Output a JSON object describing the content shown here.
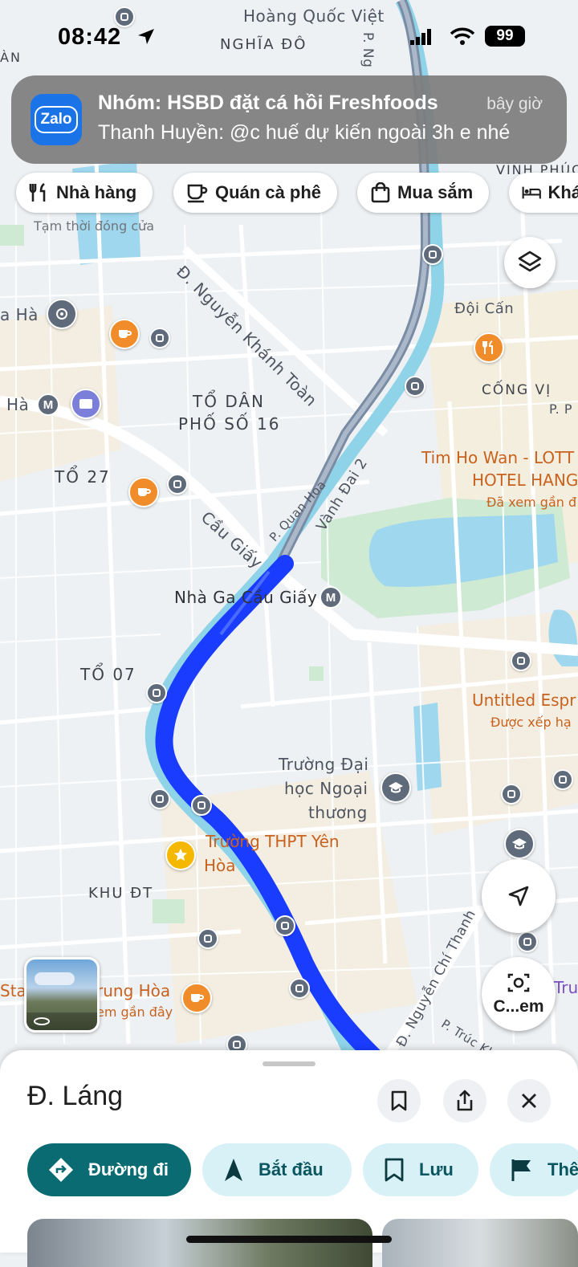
{
  "status_bar": {
    "time": "08:42",
    "battery": "99"
  },
  "notification": {
    "app": "Zalo",
    "title": "Nhóm: HSBD đặt cá hồi Freshfoods",
    "time": "bây giờ",
    "message": "Thanh Huyền: @c huế dự kiến ngoài 3h e nhé"
  },
  "chips": [
    {
      "label": "Nhà hàng",
      "icon": "fork-knife-icon"
    },
    {
      "label": "Quán cà phê",
      "icon": "coffee-cup-icon"
    },
    {
      "label": "Mua sắm",
      "icon": "shopping-bag-icon"
    },
    {
      "label": "Khá",
      "icon": "bed-icon"
    }
  ],
  "map": {
    "labels": {
      "hoang_quoc_viet": "Hoàng Quốc Việt",
      "nghia_do": "NGHĨA ĐÔ",
      "an": "ÀN",
      "p_ng": "P. Ng",
      "vinh_phuc": "VĨNH PHÚC",
      "tam_thoi": "Tạm thời đóng cửa",
      "nguyen_khanh_toan": "Đ. Nguyễn Khánh Toàn",
      "a_ha": "a Hà",
      "doi_can": "Đội Cấn",
      "cong_vi": "CỐNG VỊ",
      "pp": "P. P",
      "ha": "Hà",
      "to_dan_1": "TỔ DÂN",
      "to_dan_2": "PHỐ SỐ 16",
      "tim_ho_wan": "Tim Ho Wan - LOTT",
      "hotel_hang": "HOTEL HANG",
      "da_xem": "Đã xem gần đ",
      "to_27": "TỔ 27",
      "quan_hoa": "P. Quan Hoa",
      "vanh_dai_2": "Vành Đai 2",
      "cau_giay": "Cầu Giấy",
      "nha_ga": "Nhà Ga Cầu Giấy",
      "to_07": "TỔ 07",
      "untitled": "Untitled Espr",
      "duoc_xep": "Được xếp hạ",
      "truong_dai_hoc_1": "Trường Đại",
      "truong_dai_hoc_2": "học Ngoại",
      "truong_dai_hoc_3": "thương",
      "truong_thpt_1": "Trường THPT Yên",
      "truong_thpt_2": "Hòa",
      "khu_dt": "KHU ĐT",
      "sta": "Sta",
      "trung_hoa": "rung Hòa",
      "em_gan_day": "em gần đây",
      "nguyen_chi_thanh": "Đ. Nguyễn Chí Thanh",
      "truc_khe": "P. Trúc Khê",
      "tru": "Tru"
    },
    "metro_letter": "M",
    "camera_button": "C...em"
  },
  "place": {
    "title": "Đ. Láng",
    "actions": [
      {
        "label": "Đường đi",
        "icon": "directions-icon"
      },
      {
        "label": "Bắt đầu",
        "icon": "navigation-arrow-icon"
      },
      {
        "label": "Lưu",
        "icon": "bookmark-icon"
      },
      {
        "label": "Thê",
        "icon": "flag-icon"
      }
    ]
  },
  "colors": {
    "route": "#1a3cff",
    "primary_button": "#0b6b73",
    "secondary_button": "#d7f1f6"
  }
}
